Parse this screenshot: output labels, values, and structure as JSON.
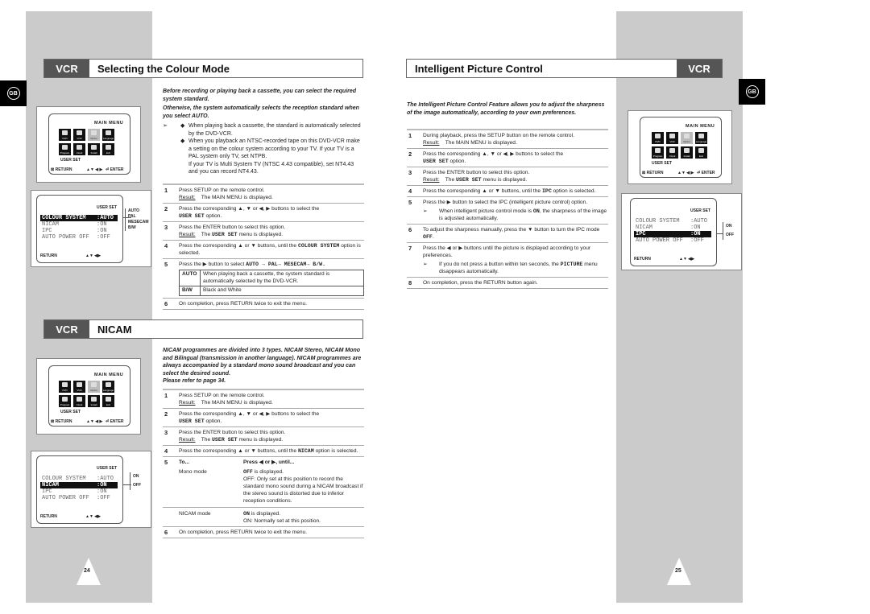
{
  "left_page": {
    "gb_badge": "GB",
    "page_number": "24",
    "colour_section": {
      "tag": "VCR",
      "title": "Selecting the Colour Mode",
      "intro": [
        "Before recording or playing back a cassette, you can select the required system standard.",
        "Otherwise, the system automatically selects the reception standard when you select AUTO."
      ],
      "notes": [
        "When playing back a cassette, the standard is automatically selected by the DVD-VCR.",
        "When you playback an NTSC-recorded tape on this DVD-VCR make a setting on the colour system according to your TV.  If your TV is a  PAL system only TV, set NTPB.",
        "If your TV is Multi System TV (NTSC 4.43 compatible), set NT4.43 and you can record NT4.43."
      ],
      "steps": [
        {
          "n": "1",
          "text": "Press SETUP on the remote control.",
          "result": "The MAIN MENU is displayed."
        },
        {
          "n": "2",
          "text": "Press the corresponding ▲, ▼ or ◀, ▶ buttons to select the",
          "mono": "USER SET",
          "after": " option."
        },
        {
          "n": "3",
          "text": "Press the ENTER button to select this option.",
          "result_pre": "The ",
          "result_mono": "USER SET",
          "result_post": " menu is displayed."
        },
        {
          "n": "4",
          "text": "Press the corresponding ▲ or ▼ buttons, until the ",
          "mono": "COLOUR SYSTEM",
          "after": " option is selected."
        },
        {
          "n": "5",
          "text": "Press the ▶ button to select ",
          "mono": "AUTO → PAL→ MESECAM→ B/W."
        },
        {
          "n": "6",
          "text": "On completion, press RETURN twice to exit the menu."
        }
      ],
      "table": [
        {
          "k": "AUTO",
          "v": "When playing back a cassette, the system standard is automatically selected by the DVD-VCR."
        },
        {
          "k": "B/W",
          "v": "Black and White"
        }
      ],
      "options": [
        "AUTO",
        "PAL",
        "MESECAM",
        "B/W"
      ]
    },
    "nicam_section": {
      "tag": "VCR",
      "title": "NICAM",
      "intro": "NICAM programmes are divided into 3 types. NICAM Stereo, NICAM Mono and Bilingual (transmission in another language). NICAM programmes are always accompanied by a standard mono sound broadcast and you can select the desired sound.",
      "refer": "Please refer to page 34.",
      "steps": [
        {
          "n": "1",
          "text": "Press SETUP on the remote control.",
          "result": "The MAIN MENU is displayed."
        },
        {
          "n": "2",
          "text": "Press the corresponding ▲, ▼ or ◀, ▶ buttons to select the",
          "mono": "USER SET",
          "after": " option."
        },
        {
          "n": "3",
          "text": "Press the ENTER button to select this option.",
          "result_pre": "The ",
          "result_mono": "USER SET",
          "result_post": " menu is displayed."
        },
        {
          "n": "4",
          "text": "Press the corresponding ▲ or ▼ buttons, until the ",
          "mono": "NICAM",
          "after": " option is selected."
        },
        {
          "n": "5",
          "col1": "To...",
          "col2": "Press ◀ or ▶, until..."
        },
        {
          "n": "6",
          "text": "On completion, press RETURN twice to exit the menu."
        }
      ],
      "modes": [
        {
          "mode": "Mono mode",
          "disp": "OFF",
          "disp_after": " is displayed.",
          "desc": "OFF: Only set at this position to record the standard  mono sound during a NICAM broadcast if the stereo sound is distorted due to inferior reception conditions."
        },
        {
          "mode": "NICAM mode",
          "disp": "ON",
          "disp_after": " is displayed.",
          "desc": "ON: Normally set at this position."
        }
      ],
      "options": [
        "ON",
        "OFF"
      ]
    }
  },
  "right_page": {
    "gb_badge": "GB",
    "page_number": "25",
    "tag": "VCR",
    "title": "Intelligent Picture Control",
    "intro": "The Intelligent Picture Control Feature allows you to adjust the sharpness of the image automatically, according to your own preferences.",
    "steps": [
      {
        "n": "1",
        "text": "During playback, press the SETUP button on the remote control.",
        "result": "The MAIN MENU is displayed."
      },
      {
        "n": "2",
        "text": "Press the corresponding ▲, ▼ or ◀, ▶ buttons to select the",
        "mono": "USER SET",
        "after": " option."
      },
      {
        "n": "3",
        "text": "Press the ENTER button to select this option.",
        "result_pre": "The ",
        "result_mono": "USER SET",
        "result_post": " menu is displayed."
      },
      {
        "n": "4",
        "text": "Press the corresponding ▲ or ▼ buttons, until the ",
        "mono": "IPC",
        "after": " option is selected."
      },
      {
        "n": "5",
        "text": "Press the ▶ button to select the IPC (intelligent picture control) option.",
        "note_pre": "When intelligent picture control mode is ",
        "note_mono": "ON",
        "note_post": ", the sharpness of the image is adjusted automatically."
      },
      {
        "n": "6",
        "text": "To adjust the sharpness manually, press the ▼ button to turn the IPC mode ",
        "mono": "OFF",
        "after": "."
      },
      {
        "n": "7",
        "text": "Press the ◀ or ▶ buttons until the picture is displayed according to your preferences.",
        "note_pre": "If you do not press a button within ten seconds, the ",
        "note_mono": "PICTURE",
        "note_post": " menu disappears automatically."
      },
      {
        "n": "8",
        "text": "On completion, press the RETURN button again."
      }
    ],
    "options": [
      "ON",
      "OFF"
    ]
  },
  "main_menu": {
    "title": "MAIN MENU",
    "icons": [
      "DVD",
      "VCR",
      "Option",
      "Language",
      "Program",
      "Clock",
      "Install",
      "Exit"
    ],
    "user_set": "USER SET",
    "return": "RETURN",
    "nav": "▲▼ ◀ ▶",
    "enter": "ENTER"
  },
  "user_set_menu": {
    "title": "USER SET",
    "rows": [
      {
        "label": "COLOUR SYSTEM",
        "value": ":AUTO"
      },
      {
        "label": "NICAM",
        "value": ":ON"
      },
      {
        "label": "IPC",
        "value": ":ON"
      },
      {
        "label": "AUTO POWER OFF",
        "value": ":OFF"
      }
    ],
    "return": "RETURN",
    "nav": "▲▼ ◀▶"
  },
  "symbols": {
    "arrow_note": "➢",
    "bullet": "◆",
    "result_label": "Result:"
  }
}
